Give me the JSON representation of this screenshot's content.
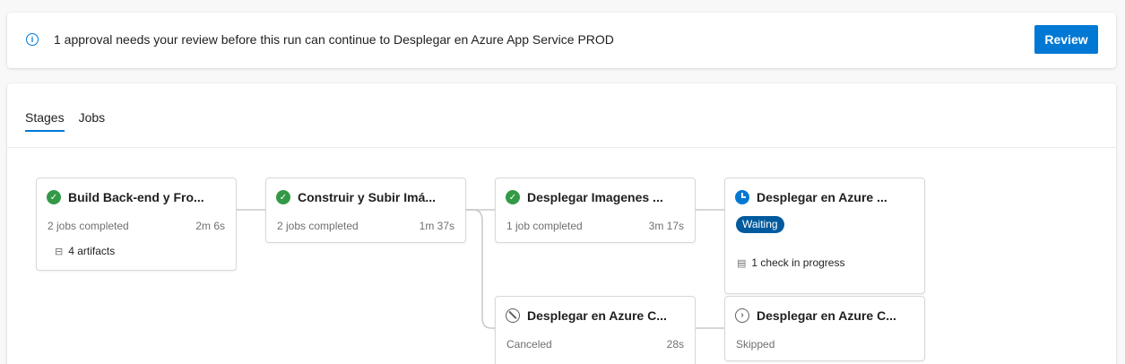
{
  "banner": {
    "icon": "info-icon",
    "message": "1 approval needs your review before this run can continue to Desplegar en Azure App Service PROD",
    "review_label": "Review",
    "accent_color": "#0078d4"
  },
  "tabs": [
    {
      "label": "Stages",
      "active": true
    },
    {
      "label": "Jobs",
      "active": false
    }
  ],
  "stages": [
    {
      "title": "Build Back-end y Fro...",
      "status": "succeeded",
      "status_icon": "check-circle-icon",
      "jobs": "2 jobs completed",
      "duration": "2m 6s",
      "artifacts": "4 artifacts"
    },
    {
      "title": "Construir y Subir Imá...",
      "status": "succeeded",
      "status_icon": "check-circle-icon",
      "jobs": "2 jobs completed",
      "duration": "1m 37s"
    },
    {
      "title": "Desplegar Imagenes ...",
      "status": "succeeded",
      "status_icon": "check-circle-icon",
      "jobs": "1 job completed",
      "duration": "3m 17s"
    },
    {
      "title": "Desplegar en Azure ...",
      "status": "waiting",
      "status_icon": "clock-icon",
      "badge": "Waiting",
      "check": "1 check in progress"
    },
    {
      "title": "Desplegar en Azure C...",
      "status": "canceled",
      "status_icon": "cancel-icon",
      "jobs": "Canceled",
      "duration": "28s"
    },
    {
      "title": "Desplegar en Azure C...",
      "status": "skipped",
      "status_icon": "skip-icon",
      "jobs": "Skipped"
    }
  ],
  "colors": {
    "success": "#339947",
    "waiting": "#0078d4",
    "badge": "#005a9e"
  }
}
